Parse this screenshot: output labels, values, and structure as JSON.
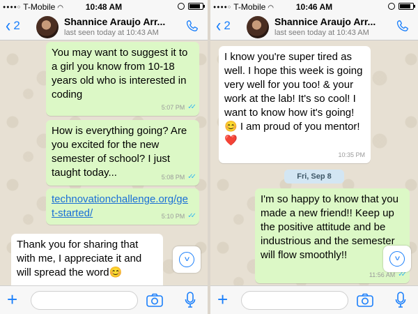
{
  "screens": [
    {
      "status": {
        "carrier": "T-Mobile",
        "time": "10:48 AM",
        "battery_level": 0.85
      },
      "header": {
        "back_count": "2",
        "contact_name": "Shannice Araujo Arr...",
        "last_seen": "last seen today at 10:43 AM"
      },
      "messages": [
        {
          "direction": "outgoing",
          "text": "You may want to suggest it to a girl you know from 10-18 years old who is interested in coding",
          "time": "5:07 PM",
          "status": "read"
        },
        {
          "direction": "outgoing",
          "text": "How is everything going? Are you excited for the new semester of school? I just taught today...",
          "time": "5:08 PM",
          "status": "read"
        },
        {
          "direction": "outgoing",
          "text": "technovationchallenge.org/get-started/",
          "link": true,
          "time": "5:10 PM",
          "status": "read"
        },
        {
          "direction": "incoming",
          "text": "Thank you for sharing that with me, I appreciate it and will spread the word😊",
          "time": ""
        }
      ]
    },
    {
      "status": {
        "carrier": "T-Mobile",
        "time": "10:46 AM",
        "battery_level": 0.85
      },
      "header": {
        "back_count": "2",
        "contact_name": "Shannice Araujo Arr...",
        "last_seen": "last seen today at 10:43 AM"
      },
      "messages": [
        {
          "direction": "incoming",
          "text": "I know you're super tired as well. I hope this week is going very well for you too! & your work at the lab! It's so cool! I want to know how it's going!😊 I am proud of you mentor!❤️",
          "time": "10:35 PM"
        },
        {
          "direction": "outgoing",
          "text": "I'm so happy to know that you made a new friend!! Keep up the positive attitude and be industrious and the semester will flow smoothly!!",
          "time": "11:56 AM",
          "status": "read"
        }
      ],
      "date_separator": "Fri, Sep 8"
    }
  ],
  "icons": {
    "back": "chevron-left-icon",
    "call": "phone-icon",
    "add": "plus-icon",
    "camera": "camera-icon",
    "microphone": "microphone-icon",
    "scroll_down": "chevron-down-icon"
  },
  "colors": {
    "accent": "#1a7ffb",
    "outgoing_bubble": "#dcf8c6",
    "incoming_bubble": "#ffffff",
    "read_ticks": "#34b7f1",
    "date_pill": "#d3e6f3"
  }
}
